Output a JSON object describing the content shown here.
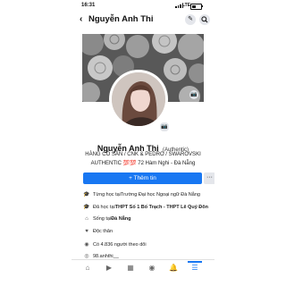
{
  "status_bar": {
    "time": "16:31",
    "network": "LTE",
    "battery_level": 0.45
  },
  "header": {
    "back_icon": "chevron-left",
    "title": "Nguyễn Anh Thi",
    "edit_icon": "pencil",
    "search_icon": "magnifier"
  },
  "profile": {
    "name": "Nguyễn Anh Thi",
    "name_suffix": "(Authentic)",
    "bio_line1": "HÀNG CÓ SẴN / CNK & PEDRO / SWAROVSKI",
    "bio_line2": "AUTHENTIC 💯💯   72 Hàm Nghi - Đà Nẵng"
  },
  "actions": {
    "add_story_label": "+ Thêm tin",
    "more_label": "···"
  },
  "details": [
    {
      "icon": "graduation-cap",
      "prefix": "Từng học tại ",
      "emph": "Trường Đại học Ngoại ngữ Đà Nẵng"
    },
    {
      "icon": "graduation-cap",
      "prefix": "Đã học tại ",
      "emph": "THPT Số 1 Bố Trạch - THPT Lê Quý Đôn"
    },
    {
      "icon": "home",
      "prefix": "Sống tại ",
      "emph": "Đà Nẵng"
    },
    {
      "icon": "heart",
      "prefix": "",
      "emph": "Độc thân"
    },
    {
      "icon": "rss",
      "prefix": "Có 4.836 người theo dõi",
      "emph": ""
    },
    {
      "icon": "instagram",
      "prefix": "98.anhthi__",
      "emph": ""
    }
  ],
  "tabbar": {
    "items": [
      "home",
      "video",
      "marketplace",
      "groups",
      "notifications",
      "menu"
    ],
    "active": "menu"
  },
  "colors": {
    "accent": "#1877f2",
    "cover": "#5e5e5e"
  }
}
